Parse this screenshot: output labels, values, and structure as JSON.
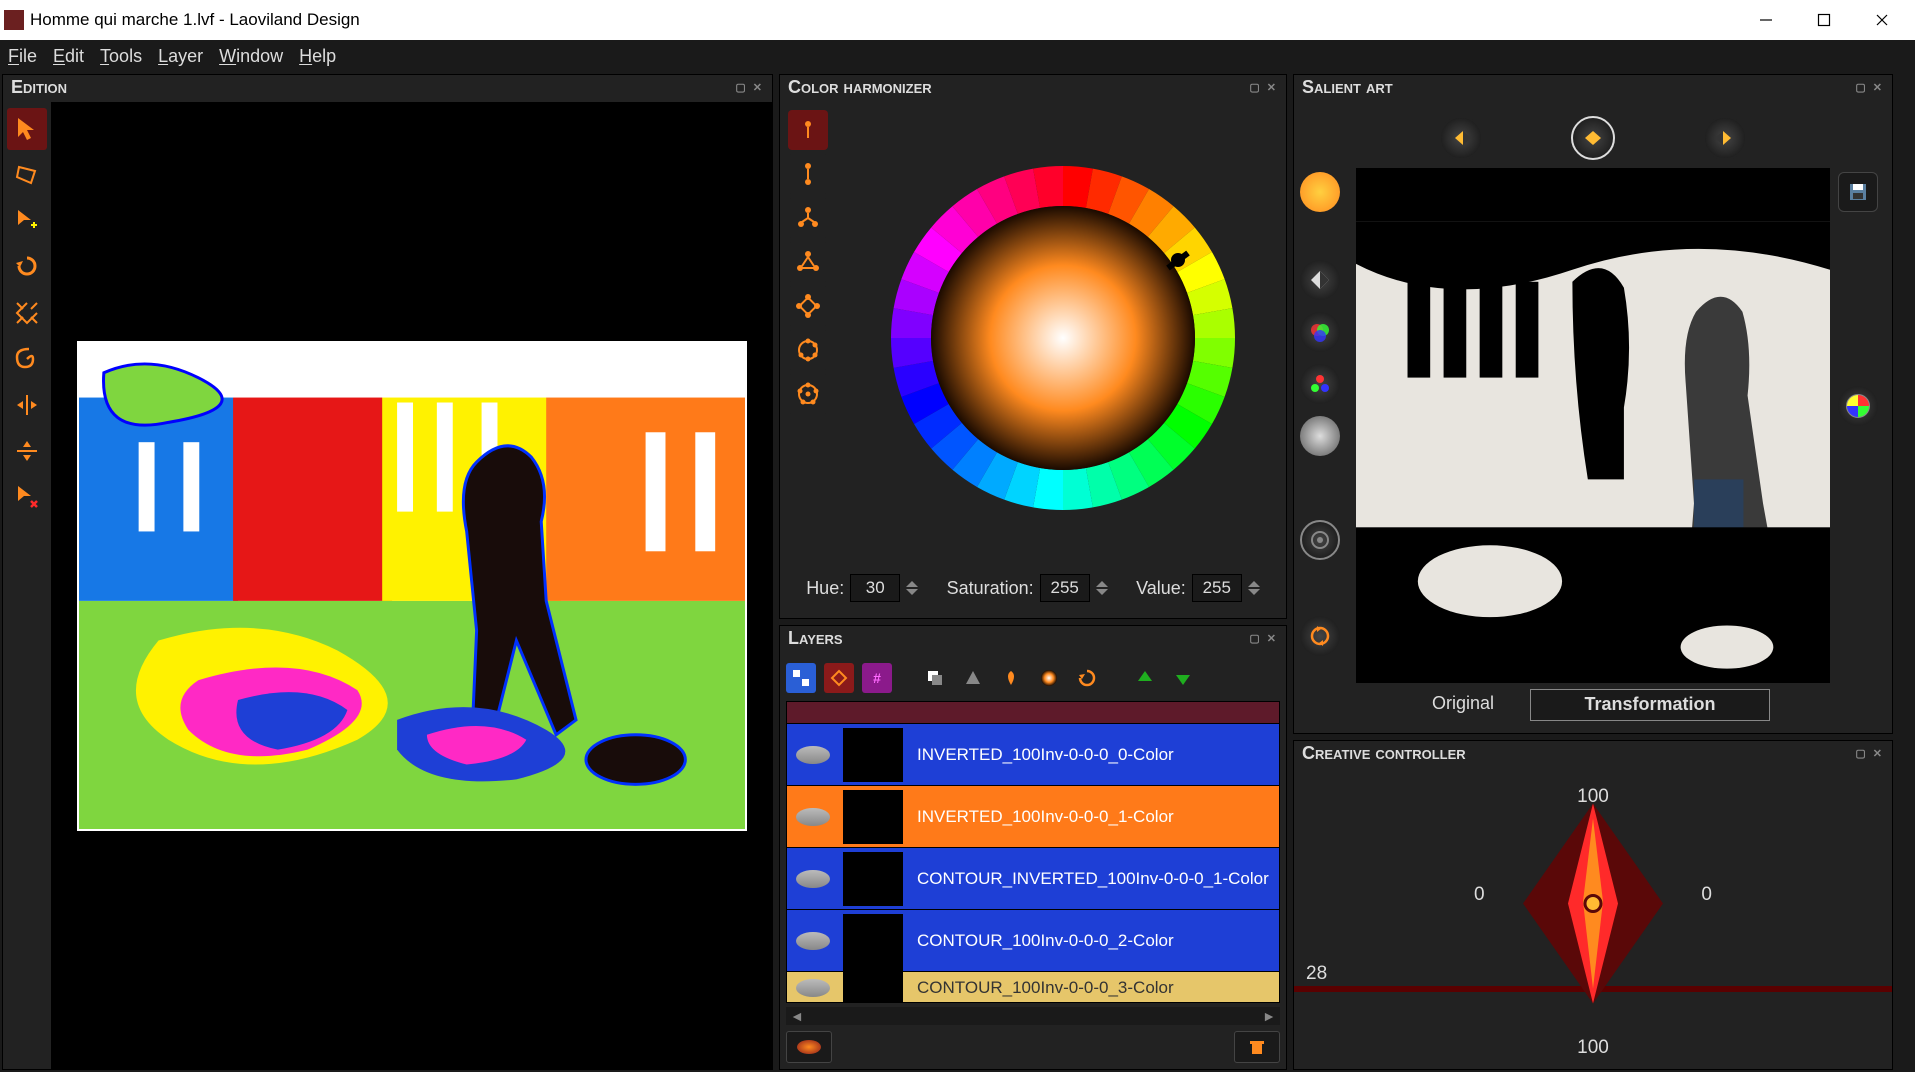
{
  "window": {
    "title": "Homme qui marche 1.lvf - Laoviland Design"
  },
  "menubar": {
    "file": "File",
    "edit": "Edit",
    "tools": "Tools",
    "layer": "Layer",
    "window": "Window",
    "help": "Help"
  },
  "panels": {
    "edition": "Edition",
    "harmonizer": "Color harmonizer",
    "layers": "Layers",
    "salient": "Salient art",
    "creative": "Creative controller"
  },
  "tools": [
    "pointer",
    "lasso",
    "move",
    "rotate",
    "scale",
    "spiral",
    "flip-h",
    "flip-v",
    "delete-point"
  ],
  "harmonizer_tools": [
    "single",
    "complementary",
    "split-complementary",
    "triadic",
    "square",
    "analogous",
    "custom"
  ],
  "hsv": {
    "hue_label": "Hue:",
    "hue_value": "30",
    "sat_label": "Saturation:",
    "sat_value": "255",
    "val_label": "Value:",
    "val_value": "255"
  },
  "layer_toolbar": [
    "showhide",
    "merge",
    "effects",
    "duplicate",
    "group",
    "paint",
    "gradient",
    "rotate",
    "up",
    "down"
  ],
  "layers_list": [
    {
      "name": "INVERTED_100Inv-0-0-0_0-Color",
      "bg": "#1e3fd6",
      "vis_bg": "#1e3fd6"
    },
    {
      "name": "INVERTED_100Inv-0-0-0_1-Color",
      "bg": "#ff7a19",
      "vis_bg": "#ff7a19"
    },
    {
      "name": "CONTOUR_INVERTED_100Inv-0-0-0_1-Color",
      "bg": "#1e3fd6",
      "vis_bg": "#1e3fd6"
    },
    {
      "name": "CONTOUR_100Inv-0-0-0_2-Color",
      "bg": "#1e3fd6",
      "vis_bg": "#1e3fd6"
    },
    {
      "name": "CONTOUR_100Inv-0-0-0_3-Color",
      "bg": "#e6c66a",
      "vis_bg": "#e6c66a"
    }
  ],
  "salient": {
    "tabs": {
      "original": "Original",
      "transformation": "Transformation"
    },
    "left_tools": [
      "color-fill",
      "contrast",
      "rgb-split",
      "channels",
      "grayscale",
      "target",
      "refresh"
    ],
    "right_tools": [
      "save",
      "wheel"
    ],
    "top_tools": [
      "prev",
      "play",
      "next"
    ]
  },
  "creative": {
    "top": "100",
    "bottom": "100",
    "left": "0",
    "right": "0",
    "slider": "28"
  },
  "colors": {
    "accent_orange": "#ff8a1f",
    "accent_red": "#6b1414",
    "panel": "#222",
    "panel_dark": "#1a1a1a"
  }
}
